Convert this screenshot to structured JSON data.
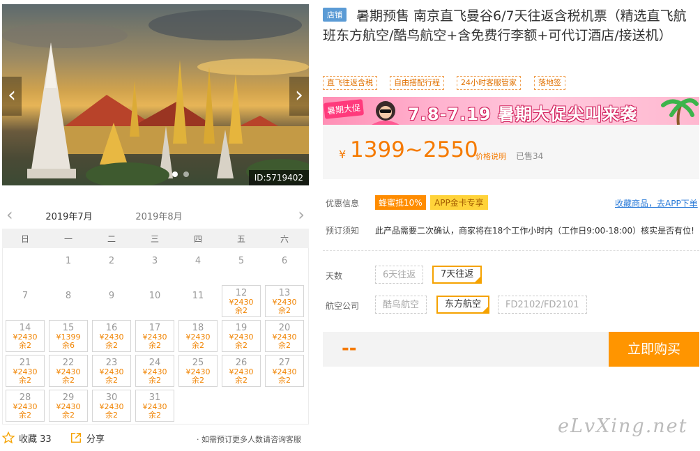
{
  "hero": {
    "id_label": "ID:5719402",
    "prev": "‹",
    "next": "›"
  },
  "calendar": {
    "months": [
      "2019年7月",
      "2019年8月"
    ],
    "active_month": 0,
    "prev": "‹",
    "next": "›",
    "weekdays": [
      "日",
      "一",
      "二",
      "三",
      "四",
      "五",
      "六"
    ],
    "offset": 1,
    "days": [
      {
        "d": "1"
      },
      {
        "d": "2"
      },
      {
        "d": "3"
      },
      {
        "d": "4"
      },
      {
        "d": "5"
      },
      {
        "d": "6"
      },
      {
        "d": "7"
      },
      {
        "d": "8"
      },
      {
        "d": "9"
      },
      {
        "d": "10"
      },
      {
        "d": "11"
      },
      {
        "d": "12",
        "p": "¥2430",
        "s": "余2"
      },
      {
        "d": "13",
        "p": "¥2430",
        "s": "余2"
      },
      {
        "d": "14",
        "p": "¥2430",
        "s": "余2"
      },
      {
        "d": "15",
        "p": "¥1399",
        "s": "余6"
      },
      {
        "d": "16",
        "p": "¥2430",
        "s": "余2"
      },
      {
        "d": "17",
        "p": "¥2430",
        "s": "余2"
      },
      {
        "d": "18",
        "p": "¥2430",
        "s": "余2"
      },
      {
        "d": "19",
        "p": "¥2430",
        "s": "余2"
      },
      {
        "d": "20",
        "p": "¥2430",
        "s": "余2"
      },
      {
        "d": "21",
        "p": "¥2430",
        "s": "余2"
      },
      {
        "d": "22",
        "p": "¥2430",
        "s": "余2"
      },
      {
        "d": "23",
        "p": "¥2430",
        "s": "余2"
      },
      {
        "d": "24",
        "p": "¥2430",
        "s": "余2"
      },
      {
        "d": "25",
        "p": "¥2430",
        "s": "余2"
      },
      {
        "d": "26",
        "p": "¥2430",
        "s": "余2"
      },
      {
        "d": "27",
        "p": "¥2430",
        "s": "余2"
      },
      {
        "d": "28",
        "p": "¥2430",
        "s": "余2"
      },
      {
        "d": "29",
        "p": "¥2430",
        "s": "余2"
      },
      {
        "d": "30",
        "p": "¥2430",
        "s": "余2"
      },
      {
        "d": "31",
        "p": "¥2430",
        "s": "余2"
      }
    ]
  },
  "footer": {
    "favorite_label": "收藏 33",
    "share_label": "分享",
    "consult_text": "· 如需预订更多人数请咨询客服"
  },
  "product": {
    "shop_badge": "店铺",
    "title": "暑期预售 南京直飞曼谷6/7天往返含税机票（精选直飞航班东方航空/酷鸟航空+含免费行李额+可代订酒店/接送机）",
    "tags": [
      "直飞往返含税",
      "自由搭配行程",
      "24小时客服管家",
      "落地签"
    ],
    "banner_tag": "暑期大促",
    "banner_text": "7.8-7.19 暑期大促尖叫来袭",
    "price_symbol": "¥",
    "price": "1399~2550",
    "price_note": "价格说明",
    "sold": "已售34"
  },
  "info": {
    "promo_label": "优惠信息",
    "promo1": "蜂蜜抵10%",
    "promo2": "APP金卡专享",
    "collect_link": "收藏商品，去APP下单",
    "notice_label": "预订须知",
    "notice_text": "此产品需要二次确认，商家将在18个工作小时内（工作日9:00-18:00）核实是否有位!"
  },
  "options": {
    "days_label": "天数",
    "days": [
      "6天往返",
      "7天往返"
    ],
    "airline_label": "航空公司",
    "airlines": [
      "酷鸟航空",
      "东方航空",
      "FD2102/FD2101"
    ]
  },
  "buy": {
    "price_placeholder": "--",
    "button": "立即购买"
  },
  "watermark": "eLvXing.net",
  "colors": {
    "accent": "#ff9500",
    "price": "#f57a00",
    "link": "#2b7bd8"
  }
}
